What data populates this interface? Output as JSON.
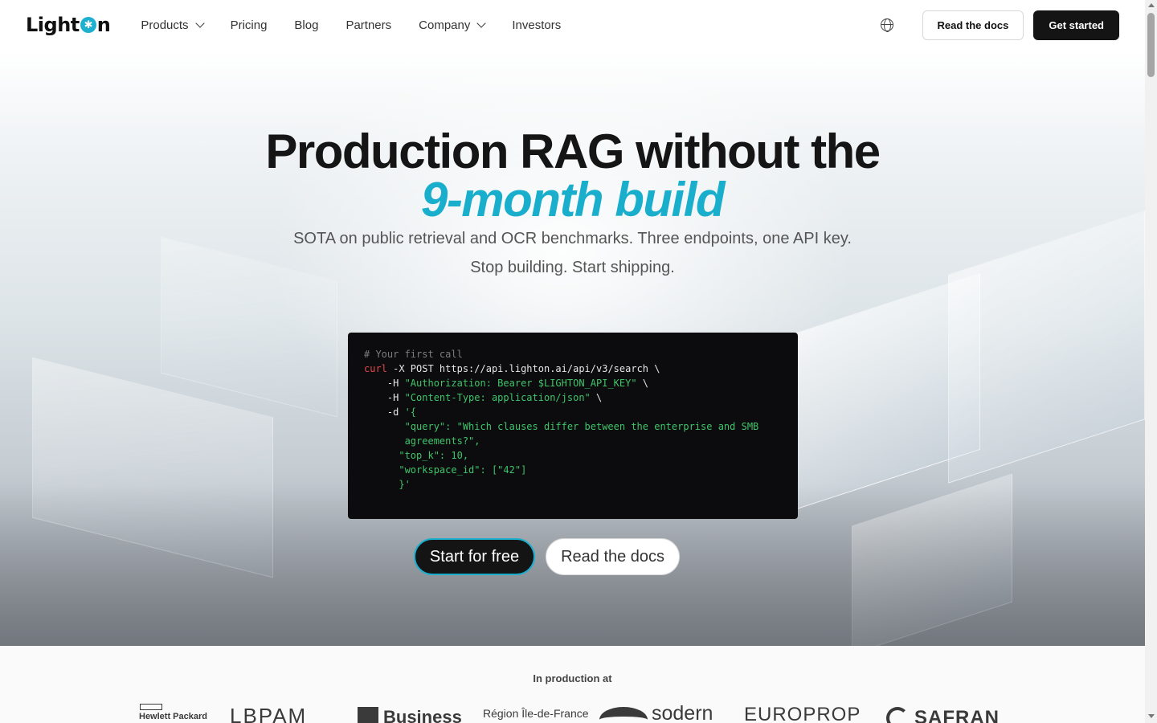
{
  "brand": {
    "name_prefix": "Light",
    "name_suffix": "n",
    "star": "✱"
  },
  "nav": {
    "items": [
      {
        "label": "Products",
        "dropdown": true
      },
      {
        "label": "Pricing",
        "dropdown": false
      },
      {
        "label": "Blog",
        "dropdown": false
      },
      {
        "label": "Partners",
        "dropdown": false
      },
      {
        "label": "Company",
        "dropdown": true
      },
      {
        "label": "Investors",
        "dropdown": false
      }
    ]
  },
  "header": {
    "docs_label": "Read the docs",
    "start_label": "Get started"
  },
  "hero": {
    "title": "Production RAG without the",
    "title_accent": "9-month build",
    "subtitle_1": "SOTA on public retrieval and OCR benchmarks. Three endpoints, one API key.",
    "subtitle_2": "Stop building. Start shipping.",
    "accent_color": "#1aaecd"
  },
  "code": {
    "comment": "# Your first call",
    "cmd": "curl",
    "line1_rest": " -X POST https://api.lighton.ai/api/v3/search \\",
    "h_flag": "    -H ",
    "auth": "\"Authorization: Bearer $LIGHTON_API_KEY\"",
    "cont": " \\",
    "content_type": "\"Content-Type: application/json\"",
    "d_flag": "    -d ",
    "open": "'{",
    "query_1": "       \"query\": \"Which clauses differ between the enterprise and SMB",
    "query_2": "       agreements?\",",
    "top_k": "      \"top_k\": 10,",
    "workspace": "      \"workspace_id\": [\"42\"]",
    "close": "      }'"
  },
  "cta": {
    "primary": "Start for free",
    "secondary": "Read the docs"
  },
  "customers": {
    "label": "In production at",
    "logos": [
      "Hewlett Packard",
      "LBPAM",
      "Business",
      "Région Île-de-France",
      "sodern",
      "EUROPROP",
      "SAFRAN"
    ]
  }
}
